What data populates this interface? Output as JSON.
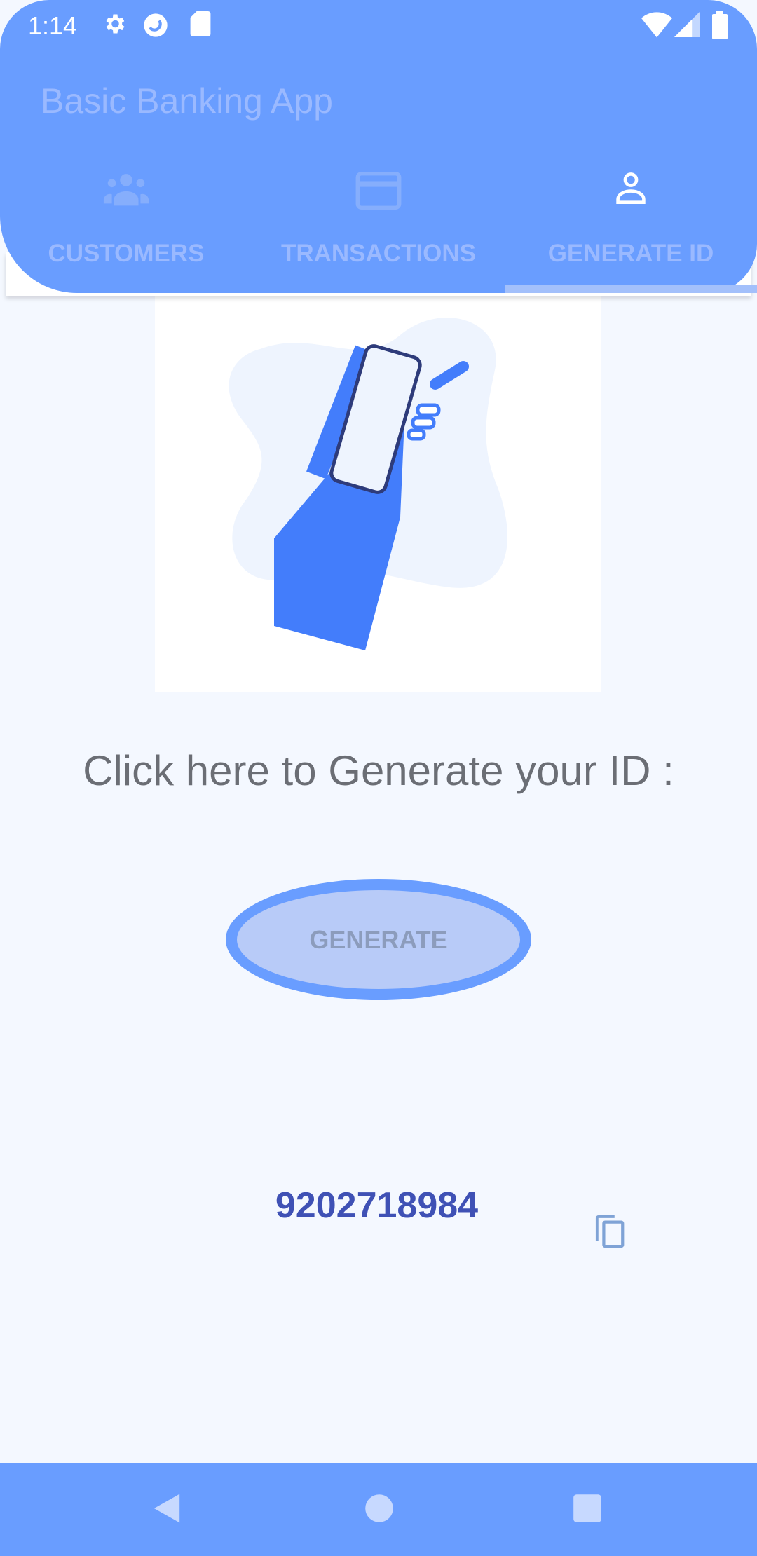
{
  "status_bar": {
    "time": "1:14",
    "icons": [
      "gear-icon",
      "sync-icon",
      "sd-card-icon",
      "wifi-icon",
      "signal-icon",
      "battery-icon"
    ]
  },
  "app_bar": {
    "title": "Basic Banking App"
  },
  "tabs": [
    {
      "label": "CUSTOMERS",
      "icon": "people-icon"
    },
    {
      "label": "TRANSACTIONS",
      "icon": "credit-card-icon"
    },
    {
      "label": "GENERATE ID",
      "icon": "person-icon",
      "selected": true
    }
  ],
  "main": {
    "prompt": "Click here to Generate your ID :",
    "generate_label": "GENERATE",
    "generated_id": "9202718984"
  },
  "colors": {
    "primary": "#699dff",
    "id_text": "#3f51b5",
    "background": "#f4f8ff"
  }
}
